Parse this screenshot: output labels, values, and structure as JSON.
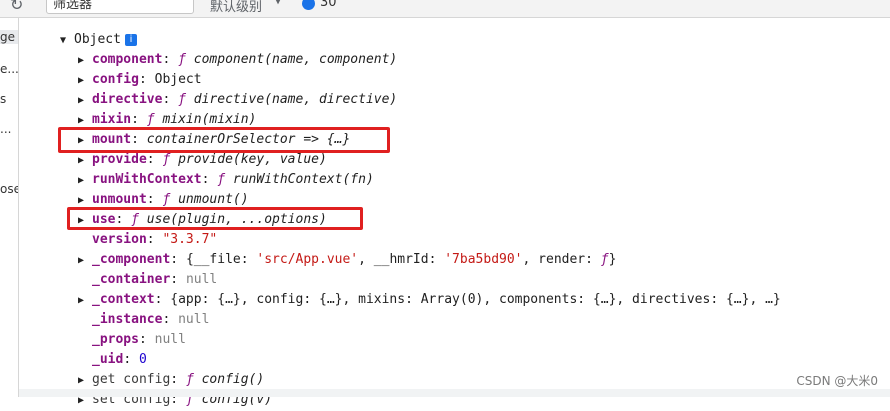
{
  "toolbar": {
    "filter_placeholder": "筛选器",
    "level_label": "默认级别",
    "message_count": "30"
  },
  "sidebar": {
    "items": [
      "ge",
      "e...",
      "s",
      "...",
      "ose"
    ]
  },
  "tree": {
    "root_label": "Object",
    "info_icon": "i",
    "rows": [
      {
        "key": "component",
        "sep": ": ",
        "ftag": "ƒ ",
        "sig": "component(name, component)"
      },
      {
        "key": "config",
        "sep": ": ",
        "value": "Object"
      },
      {
        "key": "directive",
        "sep": ": ",
        "ftag": "ƒ ",
        "sig": "directive(name, directive)"
      },
      {
        "key": "mixin",
        "sep": ": ",
        "ftag": "ƒ ",
        "sig": "mixin(mixin)"
      },
      {
        "key": "mount",
        "sep": ": ",
        "sig": "containerOrSelector => {…}"
      },
      {
        "key": "provide",
        "sep": ": ",
        "ftag": "ƒ ",
        "sig": "provide(key, value)"
      },
      {
        "key": "runWithContext",
        "sep": ": ",
        "ftag": "ƒ ",
        "sig": "runWithContext(fn)"
      },
      {
        "key": "unmount",
        "sep": ": ",
        "ftag": "ƒ ",
        "sig": "unmount()"
      },
      {
        "key": "use",
        "sep": ": ",
        "ftag": "ƒ ",
        "sig": "use(plugin, ...options)"
      },
      {
        "key": "version",
        "sep": ": ",
        "str": "\"3.3.7\""
      },
      {
        "key": "_component",
        "sep": ": ",
        "pre": "{__file: ",
        "s1": "'src/App.vue'",
        "m1": ", __hmrId: ",
        "s2": "'7ba5bd90'",
        "m2": ", render: ",
        "ftag": "ƒ",
        "post": "}"
      },
      {
        "key": "_container",
        "sep": ": ",
        "null": "null"
      },
      {
        "key": "_context",
        "sep": ": ",
        "value": "{app: {…}, config: {…}, mixins: Array(0), components: {…}, directives: {…}, …}"
      },
      {
        "key": "_instance",
        "sep": ": ",
        "null": "null"
      },
      {
        "key": "_props",
        "sep": ": ",
        "null": "null"
      },
      {
        "key": "_uid",
        "sep": ": ",
        "num": "0"
      },
      {
        "key": "get config",
        "sep": ": ",
        "ftag": "ƒ ",
        "sig": "config()"
      },
      {
        "key": "set config",
        "sep": ": ",
        "ftag": "ƒ ",
        "sig": "config(v)"
      }
    ]
  },
  "watermark": "CSDN @大米0",
  "colors": {
    "highlight_border": "#e02020",
    "key_color": "#881280",
    "string_color": "#c41a16",
    "number_color": "#1c00cf"
  }
}
